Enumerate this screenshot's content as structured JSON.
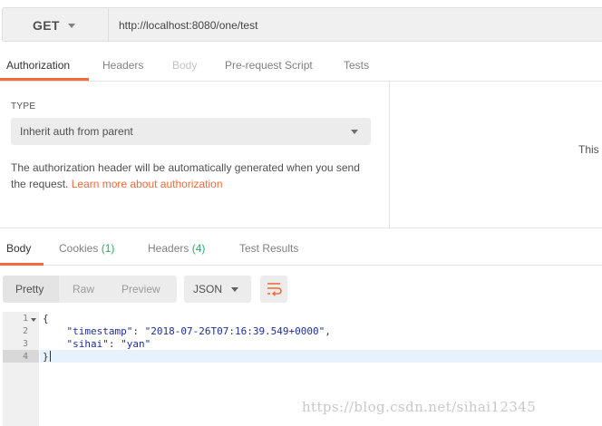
{
  "request": {
    "method": "GET",
    "url": "http://localhost:8080/one/test"
  },
  "request_tabs": [
    {
      "label": "Authorization",
      "state": "active"
    },
    {
      "label": "Headers",
      "state": "normal"
    },
    {
      "label": "Body",
      "state": "disabled"
    },
    {
      "label": "Pre-request Script",
      "state": "normal"
    },
    {
      "label": "Tests",
      "state": "normal"
    }
  ],
  "auth": {
    "type_label": "TYPE",
    "type_value": "Inherit auth from parent",
    "description": "The authorization header will be automatically generated when you send the request.",
    "link_text": "Learn more about authorization",
    "right_pane_text": "This"
  },
  "response_tabs": [
    {
      "label": "Body",
      "count": "",
      "state": "active"
    },
    {
      "label": "Cookies",
      "count": "(1)",
      "state": "normal"
    },
    {
      "label": "Headers",
      "count": "(4)",
      "state": "normal"
    },
    {
      "label": "Test Results",
      "count": "",
      "state": "normal"
    }
  ],
  "view_modes": [
    "Pretty",
    "Raw",
    "Preview"
  ],
  "selected_view_mode": "Pretty",
  "format": "JSON",
  "icons": {
    "method_caret": "chevron-down-icon",
    "auth_caret": "chevron-down-icon",
    "format_caret": "chevron-down-icon",
    "wrap": "wrap-lines-icon",
    "fold": "fold-caret-icon"
  },
  "colors": {
    "accent": "#f26b3a",
    "count": "#2eab6b",
    "code_string": "#1d2f9c"
  },
  "code": {
    "line_numbers": [
      "1",
      "2",
      "3",
      "4"
    ],
    "lines": [
      {
        "text": "{"
      },
      {
        "key": "\"timestamp\"",
        "sep": ": ",
        "value": "\"2018-07-26T07:16:39.549+0000\"",
        "tail": ","
      },
      {
        "key": "\"sihai\"",
        "sep": ": ",
        "value": "\"yan\"",
        "tail": ""
      },
      {
        "text": "}"
      }
    ],
    "active_line": 4
  },
  "watermark": "https://blog.csdn.net/sihai12345"
}
